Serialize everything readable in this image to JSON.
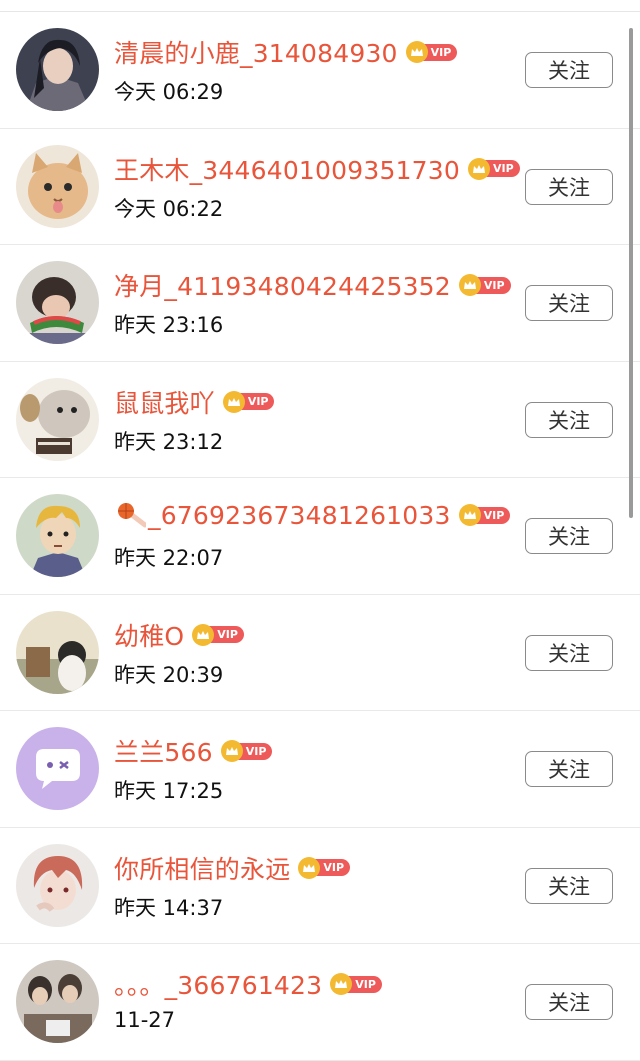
{
  "follow_label": "关注",
  "vip_label": "VIP",
  "colors": {
    "name": "#e8553a",
    "vip_tag": "#ee5a5a",
    "crown": "#f3b931",
    "border": "#8a8a8a"
  },
  "users": [
    {
      "name": "清晨的小鹿_314084930",
      "time": "今天 06:29",
      "avatar": "anime-man-avatar"
    },
    {
      "name": "王木木_3446401009351730",
      "time": "今天 06:22",
      "avatar": "cat-avatar"
    },
    {
      "name": "净月_41193480424425352",
      "time": "昨天 23:16",
      "avatar": "girl-watermelon-avatar"
    },
    {
      "name": "鼠鼠我吖",
      "time": "昨天 23:12",
      "avatar": "hamster-avatar"
    },
    {
      "name": "_676923673481261033",
      "prefix_icon": "basketball-emoji",
      "time": "昨天 22:07",
      "avatar": "anime-boy-avatar"
    },
    {
      "name": "幼稚O",
      "time": "昨天 20:39",
      "avatar": "child-photo-avatar"
    },
    {
      "name": "兰兰566",
      "time": "昨天 17:25",
      "avatar": "chat-bubble-avatar"
    },
    {
      "name": "你所相信的永远",
      "time": "昨天 14:37",
      "avatar": "anime-redhair-avatar"
    },
    {
      "name": "。。。_366761423",
      "time": "11-27",
      "avatar": "group-photo-avatar"
    }
  ]
}
